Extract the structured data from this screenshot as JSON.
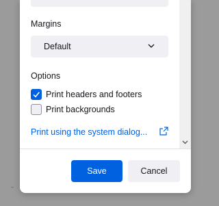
{
  "dialog": {
    "margins_label": "Margins",
    "margins_value": "Default",
    "options_label": "Options",
    "options": [
      {
        "label": "Print headers and footers",
        "checked": true
      },
      {
        "label": "Print backgrounds",
        "checked": false
      }
    ],
    "system_dialog_link": "Print using the system dialog...",
    "save_label": "Save",
    "cancel_label": "Cancel"
  },
  "icons": {
    "select_arrow": "chevron-down-icon",
    "external": "external-link-icon",
    "check": "checkmark-icon",
    "scroll_down": "scroll-down-icon"
  },
  "colors": {
    "accent": "#0061e0",
    "button_secondary": "#f0f0f4",
    "text": "#15141a"
  }
}
